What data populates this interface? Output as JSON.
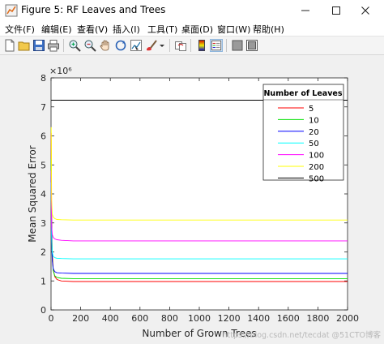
{
  "window": {
    "title": "Figure 5: RF Leaves and Trees"
  },
  "menu": {
    "items": [
      {
        "label": "文件(F)"
      },
      {
        "label": "编辑(E)"
      },
      {
        "label": "查看(V)"
      },
      {
        "label": "插入(I)"
      },
      {
        "label": "工具(T)"
      },
      {
        "label": "桌面(D)"
      },
      {
        "label": "窗口(W)"
      },
      {
        "label": "帮助(H)"
      }
    ]
  },
  "toolbar": {
    "icons": [
      "new-figure-icon",
      "open-icon",
      "save-icon",
      "print-icon",
      "zoom-in-icon",
      "zoom-out-icon",
      "pan-icon",
      "rotate-icon",
      "data-cursor-icon",
      "brush-icon",
      "link-icon",
      "colorbar-icon",
      "legend-icon",
      "hide-plot-tools-icon",
      "show-plot-tools-icon"
    ]
  },
  "colors": {
    "5": "#ff0000",
    "10": "#00e000",
    "20": "#0000ff",
    "50": "#00ffff",
    "100": "#ff00ff",
    "200": "#ffff00",
    "500": "#000000"
  },
  "chart_data": {
    "type": "line",
    "xlabel": "Number of Grown Trees",
    "ylabel": "Mean Squared Error",
    "exponent_label": "×10⁶",
    "xlim": [
      0,
      2000
    ],
    "ylim": [
      0,
      8
    ],
    "x_ticks": [
      "0",
      "200",
      "400",
      "600",
      "800",
      "1000",
      "1200",
      "1400",
      "1600",
      "1800",
      "2000"
    ],
    "y_ticks": [
      "0",
      "1",
      "2",
      "3",
      "4",
      "5",
      "6",
      "7",
      "8"
    ],
    "grid": false,
    "legend": {
      "title": "Number of Leaves",
      "position": "top-right"
    },
    "series": [
      {
        "name": "5",
        "points": [
          [
            1,
            6.1
          ],
          [
            4,
            3.3
          ],
          [
            8,
            2.0
          ],
          [
            15,
            1.4
          ],
          [
            25,
            1.15
          ],
          [
            40,
            1.05
          ],
          [
            70,
            1.0
          ],
          [
            150,
            0.98
          ],
          [
            400,
            0.98
          ],
          [
            1000,
            0.98
          ],
          [
            2000,
            0.98
          ]
        ]
      },
      {
        "name": "10",
        "points": [
          [
            1,
            5.2
          ],
          [
            4,
            2.8
          ],
          [
            8,
            1.8
          ],
          [
            15,
            1.35
          ],
          [
            25,
            1.18
          ],
          [
            40,
            1.12
          ],
          [
            70,
            1.09
          ],
          [
            150,
            1.08
          ],
          [
            400,
            1.08
          ],
          [
            1000,
            1.08
          ],
          [
            2000,
            1.08
          ]
        ]
      },
      {
        "name": "20",
        "points": [
          [
            1,
            4.6
          ],
          [
            4,
            2.5
          ],
          [
            8,
            1.7
          ],
          [
            15,
            1.42
          ],
          [
            25,
            1.32
          ],
          [
            40,
            1.28
          ],
          [
            70,
            1.27
          ],
          [
            150,
            1.26
          ],
          [
            400,
            1.26
          ],
          [
            1000,
            1.26
          ],
          [
            2000,
            1.26
          ]
        ]
      },
      {
        "name": "50",
        "points": [
          [
            1,
            4.4
          ],
          [
            4,
            2.6
          ],
          [
            8,
            2.0
          ],
          [
            15,
            1.85
          ],
          [
            25,
            1.8
          ],
          [
            40,
            1.78
          ],
          [
            70,
            1.77
          ],
          [
            150,
            1.76
          ],
          [
            400,
            1.76
          ],
          [
            1000,
            1.76
          ],
          [
            2000,
            1.76
          ]
        ]
      },
      {
        "name": "100",
        "points": [
          [
            1,
            4.8
          ],
          [
            4,
            2.9
          ],
          [
            8,
            2.6
          ],
          [
            15,
            2.5
          ],
          [
            25,
            2.45
          ],
          [
            40,
            2.42
          ],
          [
            70,
            2.4
          ],
          [
            150,
            2.38
          ],
          [
            400,
            2.38
          ],
          [
            1000,
            2.38
          ],
          [
            2000,
            2.38
          ]
        ]
      },
      {
        "name": "200",
        "points": [
          [
            1,
            6.3
          ],
          [
            4,
            3.8
          ],
          [
            8,
            3.3
          ],
          [
            15,
            3.2
          ],
          [
            25,
            3.15
          ],
          [
            40,
            3.12
          ],
          [
            70,
            3.11
          ],
          [
            150,
            3.1
          ],
          [
            400,
            3.1
          ],
          [
            1000,
            3.1
          ],
          [
            2000,
            3.1
          ]
        ]
      },
      {
        "name": "500",
        "points": [
          [
            1,
            7.23
          ],
          [
            100,
            7.23
          ],
          [
            1000,
            7.23
          ],
          [
            2000,
            7.23
          ]
        ]
      }
    ]
  },
  "watermark": "https://blog.csdn.net/tecdat @51CTO博客"
}
